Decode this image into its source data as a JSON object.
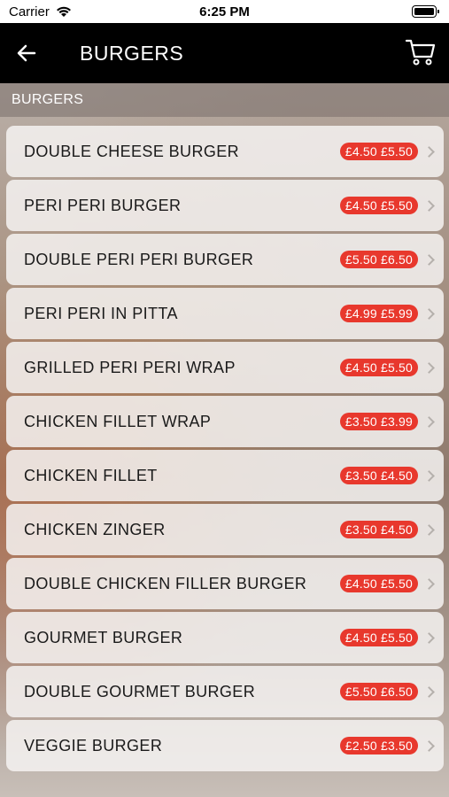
{
  "status_bar": {
    "carrier": "Carrier",
    "time": "6:25 PM"
  },
  "nav": {
    "title": "BURGERS"
  },
  "section": {
    "header": "BURGERS"
  },
  "items": [
    {
      "name": "DOUBLE CHEESE BURGER",
      "price": "£4.50 £5.50"
    },
    {
      "name": "PERI PERI BURGER",
      "price": "£4.50 £5.50"
    },
    {
      "name": "DOUBLE PERI PERI BURGER",
      "price": "£5.50 £6.50"
    },
    {
      "name": "PERI PERI IN PITTA",
      "price": "£4.99 £5.99"
    },
    {
      "name": "GRILLED PERI PERI WRAP",
      "price": "£4.50 £5.50"
    },
    {
      "name": "CHICKEN FILLET WRAP",
      "price": "£3.50 £3.99"
    },
    {
      "name": "CHICKEN FILLET",
      "price": "£3.50 £4.50"
    },
    {
      "name": "CHICKEN ZINGER",
      "price": "£3.50 £4.50"
    },
    {
      "name": "DOUBLE CHICKEN FILLER BURGER",
      "price": "£4.50 £5.50"
    },
    {
      "name": "GOURMET BURGER",
      "price": "£4.50 £5.50"
    },
    {
      "name": "DOUBLE GOURMET BURGER",
      "price": "£5.50 £6.50"
    },
    {
      "name": "VEGGIE BURGER",
      "price": "£2.50 £3.50"
    }
  ],
  "colors": {
    "price_badge": "#e8382d",
    "nav_background": "#000000"
  },
  "icons": {
    "back": "arrow-left-icon",
    "cart": "shopping-cart-icon",
    "wifi": "wifi-icon",
    "battery": "battery-icon",
    "chevron": "chevron-right-icon"
  }
}
